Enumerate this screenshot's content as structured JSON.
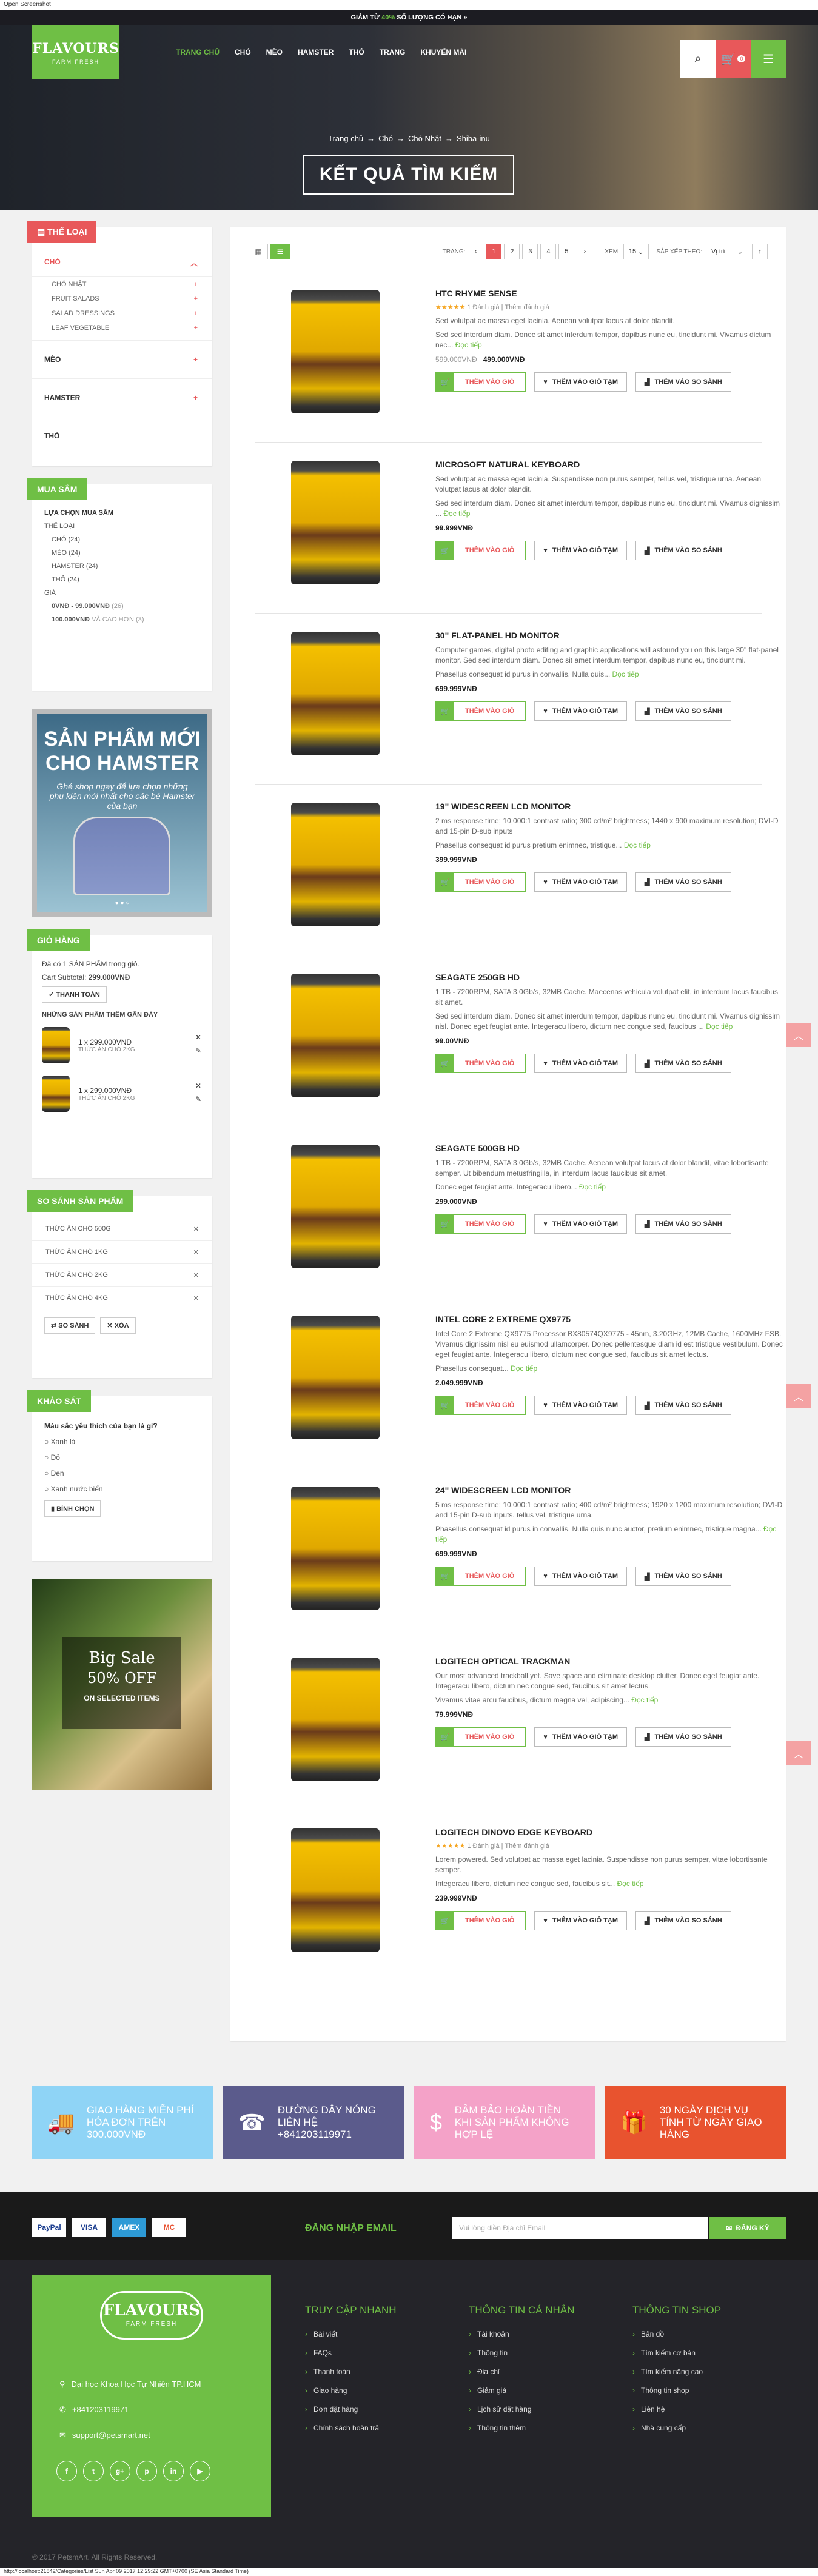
{
  "window_title": "Open Screenshot",
  "topbar": {
    "pre": "GIẢM TỪ ",
    "hl": "40%",
    "post": " SỐ LƯỢNG CÓ HẠN »"
  },
  "logo": {
    "name": "FLAVOURS",
    "tagline": "FARM FRESH"
  },
  "nav": [
    "TRANG CHỦ",
    "CHÓ",
    "MÈO",
    "HAMSTER",
    "THỎ",
    "TRANG",
    "KHUYẾN MÃI"
  ],
  "cart_count": "0",
  "breadcrumb": [
    "Trang chủ",
    "Chó",
    "Chó Nhật",
    "Shiba-inu"
  ],
  "page_title": "KẾT QUẢ TÌM KIẾM",
  "categories": {
    "title": "THỂ LOẠI",
    "chó": "CHÓ",
    "sub": [
      "CHÓ NHẬT",
      "FRUIT SALADS",
      "SALAD DRESSINGS",
      "LEAF VEGETABLE"
    ],
    "others": [
      "MÈO",
      "HAMSTER",
      "THỎ"
    ]
  },
  "shopping": {
    "title": "MUA SẮM",
    "by": "LỰA CHỌN MUA SẮM",
    "type_label": "THỂ LOẠI",
    "types": [
      "CHÓ (24)",
      "MÈO (24)",
      "HAMSTER (24)",
      "THỎ (24)"
    ],
    "price_label": "GIÁ",
    "range1": "0VNĐ - 99.000VNĐ",
    "range1c": "(26)",
    "range2": "100.000VNĐ",
    "range2c": "VÀ CAO HƠN (3)"
  },
  "promo": {
    "title": "SẢN PHẨM MỚI CHO HAMSTER",
    "sub": "Ghé shop ngay để lựa chọn những phụ kiện mới nhất cho các bé Hamster của bạn"
  },
  "cart": {
    "title": "GIỎ HÀNG",
    "line1": "Đã có 1 SẢN PHẨM trong giỏ.",
    "subtotal_label": "Cart Subtotal:",
    "subtotal": "299.000VNĐ",
    "checkout": "THANH TOÁN",
    "recent_title": "NHỮNG SẢN PHẨM THÊM GẦN ĐÂY",
    "items": [
      {
        "qty": "1 x 299.000VNĐ",
        "name": "THỨC ĂN CHÓ 2KG"
      },
      {
        "qty": "1 x 299.000VNĐ",
        "name": "THỨC ĂN CHÓ 2KG"
      }
    ]
  },
  "compare": {
    "title": "SO SÁNH SẢN PHẨM",
    "items": [
      "THỨC ĂN CHÓ 500G",
      "THỨC ĂN CHÓ 1KG",
      "THỨC ĂN CHÓ 2KG",
      "THỨC ĂN CHÓ 4KG"
    ],
    "compare_btn": "SO SÁNH",
    "delete_btn": "XÓA"
  },
  "survey": {
    "title": "KHẢO SÁT",
    "question": "Màu sắc yêu thích của bạn là gì?",
    "options": [
      "Xanh lá",
      "Đỏ",
      "Đen",
      "Xanh nước biển"
    ],
    "vote": "BÌNH CHỌN"
  },
  "bigsale": {
    "t1": "Big Sale",
    "t2": "50% OFF",
    "t3": "ON SELECTED ITEMS"
  },
  "toolbar": {
    "page_label": "TRANG:",
    "pages": [
      "1",
      "2",
      "3",
      "4",
      "5"
    ],
    "view_label": "XEM:",
    "view_value": "15",
    "sort_label": "SẮP XẾP THEO:",
    "sort_value": "Vị trí"
  },
  "actions": {
    "add_cart": "THÊM VÀO GIỎ",
    "wishlist": "THÊM VÀO GIỎ TẠM",
    "compare": "THÊM VÀO SO SÁNH",
    "more": "Đọc tiếp"
  },
  "products": [
    {
      "name": "HTC RHYME SENSE",
      "stars": "★★★★★",
      "rating": "1 Đánh giá | Thêm đánh giá",
      "d1": "Sed volutpat ac massa eget lacinia. Aenean volutpat lacus at dolor blandit.",
      "d2": "Sed sed interdum diam. Donec sit amet interdum tempor, dapibus nunc eu, tincidunt mi. Vivamus dictum nec...",
      "old": "599.000VNĐ",
      "price": "499.000VNĐ"
    },
    {
      "name": "MICROSOFT NATURAL KEYBOARD",
      "stars": "",
      "rating": "",
      "d1": "Sed volutpat ac massa eget lacinia. Suspendisse non purus semper, tellus vel, tristique urna. Aenean volutpat lacus at dolor blandit.",
      "d2": "Sed sed interdum diam. Donec sit amet interdum tempor, dapibus nunc eu, tincidunt mi. Vivamus dignissim ...",
      "old": "",
      "price": "99.999VNĐ"
    },
    {
      "name": "30\" FLAT-PANEL HD MONITOR",
      "stars": "",
      "rating": "",
      "d1": "Computer games, digital photo editing and graphic applications will astound you on this large 30\" flat-panel monitor. Sed sed interdum diam. Donec sit amet interdum tempor, dapibus nunc eu, tincidunt mi.",
      "d2": "Phasellus consequat id purus in convallis. Nulla quis...",
      "old": "",
      "price": "699.999VNĐ"
    },
    {
      "name": "19\" WIDESCREEN LCD MONITOR",
      "stars": "",
      "rating": "",
      "d1": "2 ms response time; 10,000:1 contrast ratio; 300 cd/m² brightness; 1440 x 900 maximum resolution; DVI-D and 15-pin D-sub inputs",
      "d2": "Phasellus consequat id purus pretium enimnec, tristique...",
      "old": "",
      "price": "399.999VNĐ"
    },
    {
      "name": "SEAGATE 250GB HD",
      "stars": "",
      "rating": "",
      "d1": "1 TB - 7200RPM, SATA 3.0Gb/s, 32MB Cache. Maecenas vehicula volutpat elit, in interdum lacus faucibus sit amet.",
      "d2": "Sed sed interdum diam. Donec sit amet interdum tempor, dapibus nunc eu, tincidunt mi. Vivamus dignissim nisl. Donec eget feugiat ante. Integeracu libero, dictum nec congue sed, faucibus ...",
      "old": "",
      "price": "99.00VNĐ"
    },
    {
      "name": "SEAGATE 500GB HD",
      "stars": "",
      "rating": "",
      "d1": "1 TB - 7200RPM, SATA 3.0Gb/s, 32MB Cache. Aenean volutpat lacus at dolor blandit, vitae lobortisante semper. Ut bibendum metusfringilla, in interdum lacus faucibus sit amet.",
      "d2": "Donec eget feugiat ante. Integeracu libero...",
      "old": "",
      "price": "299.000VNĐ"
    },
    {
      "name": "INTEL CORE 2 EXTREME QX9775",
      "stars": "",
      "rating": "",
      "d1": "Intel Core 2 Extreme QX9775 Processor BX80574QX9775 - 45nm, 3.20GHz, 12MB Cache, 1600MHz FSB. Vivamus dignissim nisl eu euismod ullamcorper. Donec pellentesque diam id est tristique vestibulum. Donec eget feugiat ante. Integeracu libero, dictum nec congue sed, faucibus sit amet lectus.",
      "d2": "Phasellus consequat...",
      "old": "",
      "price": "2.049.999VNĐ"
    },
    {
      "name": "24\" WIDESCREEN LCD MONITOR",
      "stars": "",
      "rating": "",
      "d1": "5 ms response time; 10,000:1 contrast ratio; 400 cd/m² brightness; 1920 x 1200 maximum resolution; DVI-D and 15-pin D-sub inputs. tellus vel, tristique urna.",
      "d2": "Phasellus consequat id purus in convallis. Nulla quis nunc auctor, pretium enimnec, tristique magna...",
      "old": "",
      "price": "699.999VNĐ"
    },
    {
      "name": "LOGITECH OPTICAL TRACKMAN",
      "stars": "",
      "rating": "",
      "d1": "Our most advanced trackball yet. Save space and eliminate desktop clutter. Donec eget feugiat ante. Integeracu libero, dictum nec congue sed, faucibus sit amet lectus.",
      "d2": "Vivamus vitae arcu faucibus, dictum magna vel, adipiscing...",
      "old": "",
      "price": "79.999VNĐ"
    },
    {
      "name": "LOGITECH DINOVO EDGE KEYBOARD",
      "stars": "★★★★★",
      "rating": "1 Đánh giá | Thêm đánh giá",
      "d1": "Lorem powered. Sed volutpat ac massa eget lacinia. Suspendisse non purus semper, vitae lobortisante semper.",
      "d2": "Integeracu libero, dictum nec congue sed, faucibus sit...",
      "old": "",
      "price": "239.999VNĐ"
    }
  ],
  "services": [
    {
      "text": "GIAO HÀNG MIỄN PHÍ HÓA ĐƠN TRÊN 300.000VNĐ",
      "color": "#8fd4f6"
    },
    {
      "text": "ĐƯỜNG DÂY NÓNG LIÊN HỆ +841203119971",
      "color": "#5b5b8c"
    },
    {
      "text": "ĐẢM BẢO HOÀN TIỀN KHI SẢN PHẨM KHÔNG HỢP LỆ",
      "color": "#f4a2c8"
    },
    {
      "text": "30 NGÀY DỊCH VỤ TÍNH TỪ NGÀY GIAO HÀNG",
      "color": "#e8532f"
    }
  ],
  "newsletter": {
    "label": "ĐĂNG NHẬP EMAIL",
    "placeholder": "Vui lòng điền Địa chỉ Email",
    "button": "ĐĂNG KÝ",
    "payments": [
      "PayPal",
      "VISA",
      "AMEX",
      "MC"
    ]
  },
  "footer": {
    "address": "Đại học Khoa Học Tự Nhiên TP.HCM",
    "phone": "+841203119971",
    "email": "support@petsmart.net",
    "socials": [
      "f",
      "t",
      "g+",
      "p",
      "in",
      "▶"
    ],
    "cols": [
      {
        "title": "TRUY CẬP NHANH",
        "items": [
          "Bài viết",
          "FAQs",
          "Thanh toán",
          "Giao hàng",
          "Đơn đặt hàng",
          "Chính sách hoàn trả"
        ]
      },
      {
        "title": "THÔNG TIN CÁ NHÂN",
        "items": [
          "Tài khoản",
          "Thông tin",
          "Địa chỉ",
          "Giảm giá",
          "Lịch sử đặt hàng",
          "Thông tin thêm"
        ]
      },
      {
        "title": "THÔNG TIN SHOP",
        "items": [
          "Bản đồ",
          "Tìm kiếm cơ bản",
          "Tìm kiếm nâng cao",
          "Thông tin shop",
          "Liên hệ",
          "Nhà cung cấp"
        ]
      }
    ],
    "copyright": "© 2017 PetsmArt. All Rights Reserved."
  },
  "statusbar": "http://localhost:21842/Categories/List Sun Apr 09 2017 12:29:22 GMT+0700 (SE Asia Standard Time)"
}
